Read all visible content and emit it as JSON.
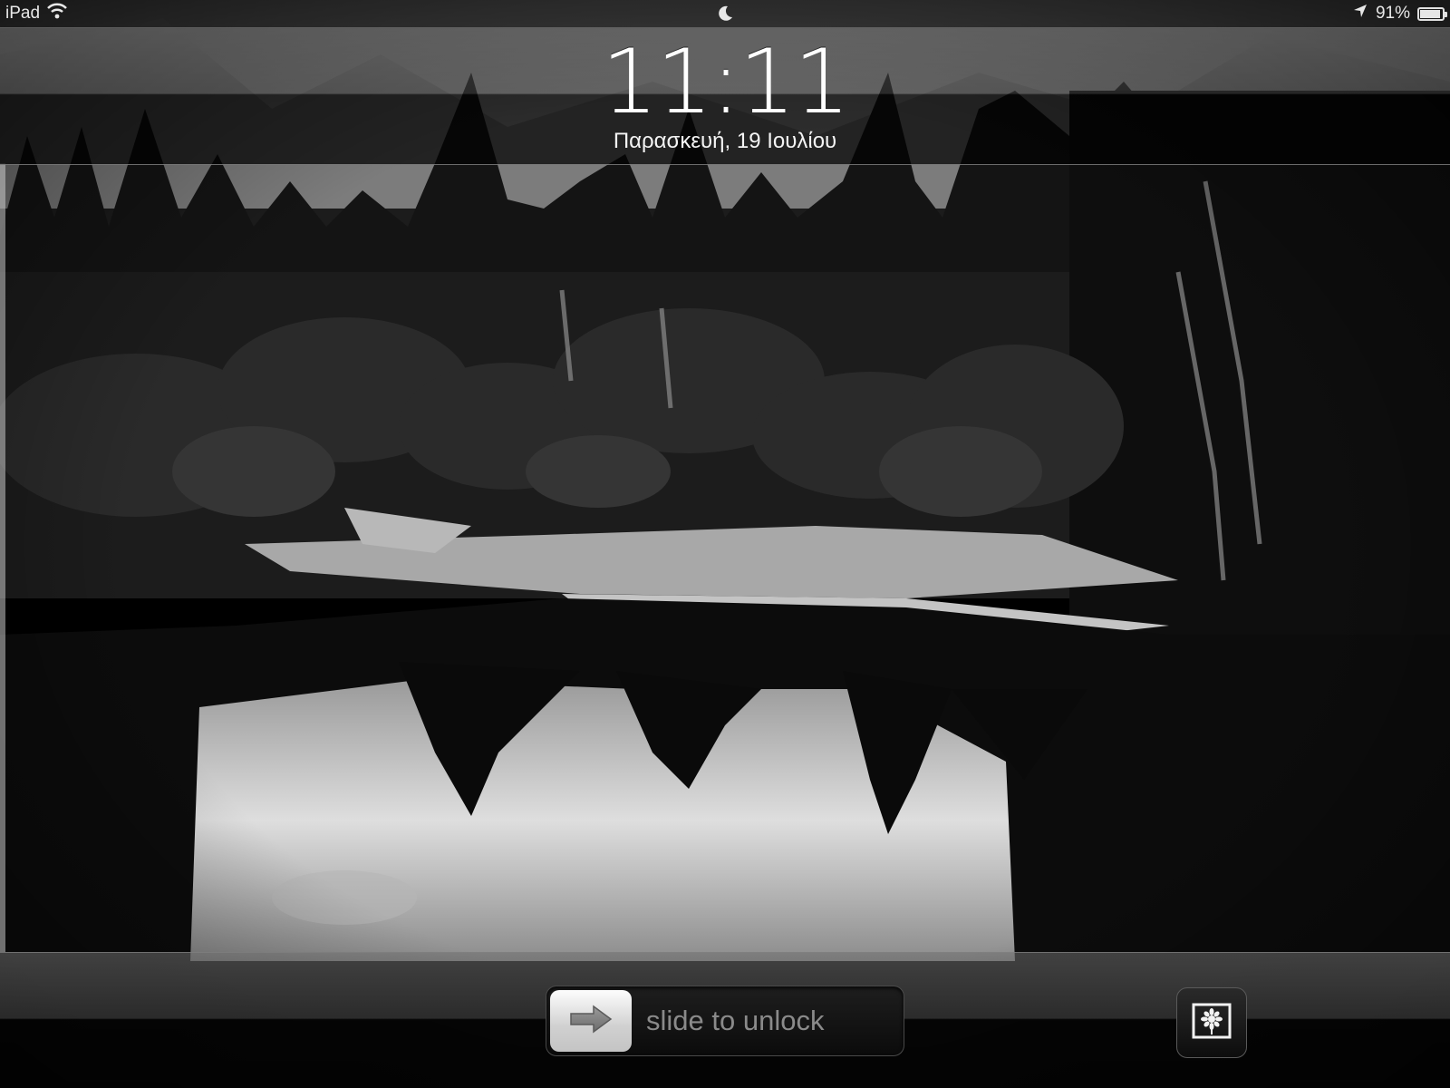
{
  "status_bar": {
    "device_label": "iPad",
    "battery_text": "91%",
    "battery_level": 0.91,
    "icons": [
      "wifi-icon",
      "moon-icon",
      "location-arrow-icon",
      "battery-icon"
    ]
  },
  "lock_screen": {
    "time": "11:11",
    "date": "Παρασκευή, 19 Ιουλίου"
  },
  "unlock": {
    "slider_label": "slide to unlock",
    "knob_icon": "arrow-right-icon"
  },
  "picture_frame_button": {
    "icon": "picture-frame-flower-icon"
  },
  "wallpaper": {
    "description_colors": {
      "sky": "#bdbdbd",
      "forest": "#1b1b1b",
      "water_reflection": "#d6d6d6"
    }
  }
}
